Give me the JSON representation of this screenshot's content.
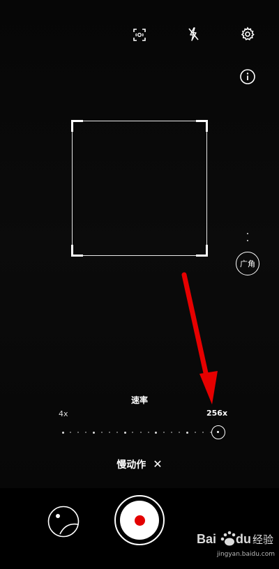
{
  "camera": {
    "mode_label": "慢动作",
    "close_symbol": "✕",
    "wide_label": "广角",
    "top_icons": [
      "motion-detection-icon",
      "flash-off-icon",
      "settings-icon"
    ],
    "info_icon": "info-icon"
  },
  "speed": {
    "title": "速率",
    "min_label": "4x",
    "max_label": "256x",
    "level": 1.0
  },
  "watermark": {
    "logo_text": "Bai du 经验",
    "url": "jingyan.baidu.com"
  },
  "colors": {
    "record": "#e30000",
    "annotation_arrow": "#e60000"
  }
}
